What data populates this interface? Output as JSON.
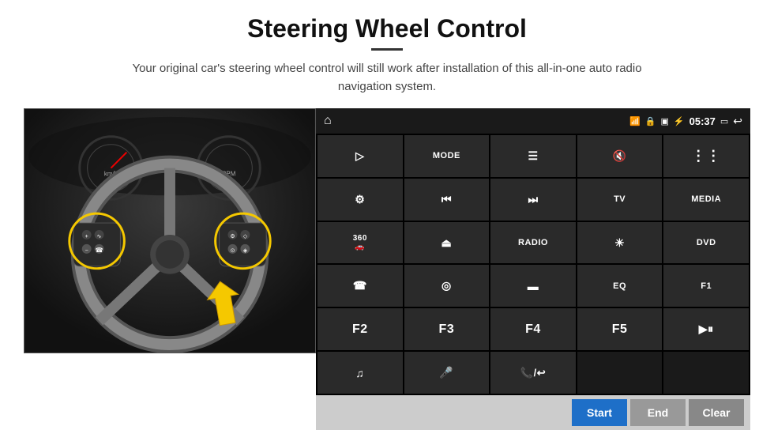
{
  "page": {
    "title": "Steering Wheel Control",
    "divider": true,
    "subtitle": "Your original car's steering wheel control will still work after installation of this all-in-one auto radio navigation system."
  },
  "status_bar": {
    "home_icon": "⌂",
    "wifi_icon": "wifi",
    "lock_icon": "lock",
    "sim_icon": "sim",
    "bluetooth_icon": "bt",
    "time": "05:37",
    "monitor_icon": "mon",
    "back_icon": "←"
  },
  "buttons": [
    {
      "id": "b1",
      "label": "▷",
      "type": "icon"
    },
    {
      "id": "b2",
      "label": "MODE",
      "type": "text"
    },
    {
      "id": "b3",
      "label": "≡",
      "type": "icon"
    },
    {
      "id": "b4",
      "label": "🔇",
      "type": "icon"
    },
    {
      "id": "b5",
      "label": "⋮⋮⋮",
      "type": "icon"
    },
    {
      "id": "b6",
      "label": "⚙",
      "type": "icon"
    },
    {
      "id": "b7",
      "label": "⏮",
      "type": "icon"
    },
    {
      "id": "b8",
      "label": "⏭",
      "type": "icon"
    },
    {
      "id": "b9",
      "label": "TV",
      "type": "text"
    },
    {
      "id": "b10",
      "label": "MEDIA",
      "type": "text"
    },
    {
      "id": "b11",
      "label": "360",
      "type": "text-small"
    },
    {
      "id": "b12",
      "label": "▲",
      "type": "icon"
    },
    {
      "id": "b13",
      "label": "RADIO",
      "type": "text"
    },
    {
      "id": "b14",
      "label": "☀",
      "type": "icon"
    },
    {
      "id": "b15",
      "label": "DVD",
      "type": "text"
    },
    {
      "id": "b16",
      "label": "☎",
      "type": "icon"
    },
    {
      "id": "b17",
      "label": "◎",
      "type": "icon"
    },
    {
      "id": "b18",
      "label": "▬",
      "type": "icon"
    },
    {
      "id": "b19",
      "label": "EQ",
      "type": "text"
    },
    {
      "id": "b20",
      "label": "F1",
      "type": "text"
    },
    {
      "id": "b21",
      "label": "F2",
      "type": "text"
    },
    {
      "id": "b22",
      "label": "F3",
      "type": "text"
    },
    {
      "id": "b23",
      "label": "F4",
      "type": "text"
    },
    {
      "id": "b24",
      "label": "F5",
      "type": "text"
    },
    {
      "id": "b25",
      "label": "▶⏸",
      "type": "icon"
    },
    {
      "id": "b26",
      "label": "♫",
      "type": "icon"
    },
    {
      "id": "b27",
      "label": "🎤",
      "type": "icon"
    },
    {
      "id": "b28",
      "label": "📞",
      "type": "icon"
    },
    {
      "id": "b29",
      "label": "",
      "type": "empty"
    },
    {
      "id": "b30",
      "label": "",
      "type": "empty"
    }
  ],
  "action_bar": {
    "start_label": "Start",
    "end_label": "End",
    "clear_label": "Clear"
  },
  "colors": {
    "panel_bg": "#1a1a1a",
    "btn_bg": "#2a2a2a",
    "start_btn": "#1e6fc8",
    "end_btn": "#999999",
    "clear_btn": "#888888",
    "action_bar_bg": "#cccccc",
    "highlight": "#f5c800"
  }
}
